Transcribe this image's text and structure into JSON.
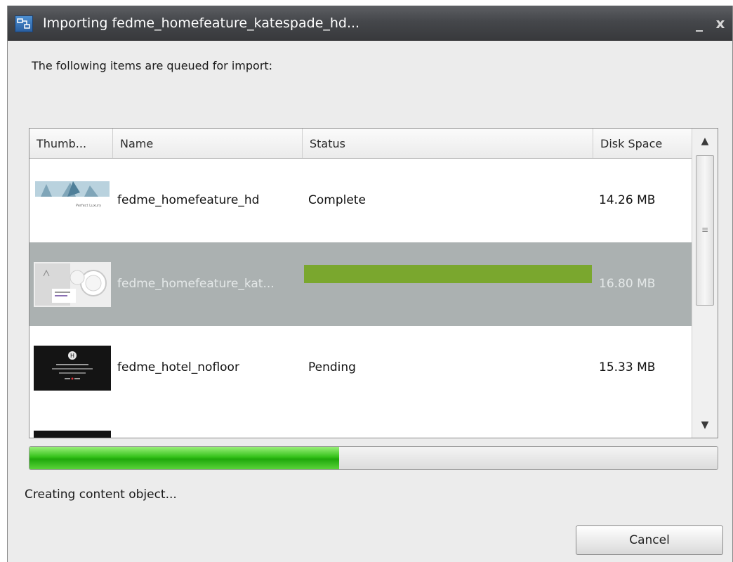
{
  "window": {
    "title": "Importing fedme_homefeature_katespade_hd...",
    "minimize_glyph": "_",
    "close_glyph": "x"
  },
  "queued_label": "The following items are queued for import:",
  "columns": {
    "thumb": "Thumb...",
    "name": "Name",
    "status": "Status",
    "disk": "Disk Space"
  },
  "rows": [
    {
      "name": "fedme_homefeature_hd",
      "status": "Complete",
      "disk": "14.26 MB",
      "selected": false,
      "thumb_text": "Perfect Luxury"
    },
    {
      "name": "fedme_homefeature_kat...",
      "status": "",
      "disk": "16.80 MB",
      "selected": true,
      "progress": 1.0
    },
    {
      "name": "fedme_hotel_nofloor",
      "status": "Pending",
      "disk": "15.33 MB",
      "selected": false
    }
  ],
  "overall_progress": 0.45,
  "status_text": "Creating content object...",
  "cancel_label": "Cancel",
  "colors": {
    "row_progress": "#7aa72e",
    "overall_progress": "#35c21a",
    "selected_row": "#abb1b1",
    "titlebar": "#45474b"
  },
  "icons": [
    "app-icon",
    "minimize-icon",
    "close-icon",
    "scroll-up-icon",
    "scroll-down-icon",
    "scroll-grip-icon"
  ]
}
